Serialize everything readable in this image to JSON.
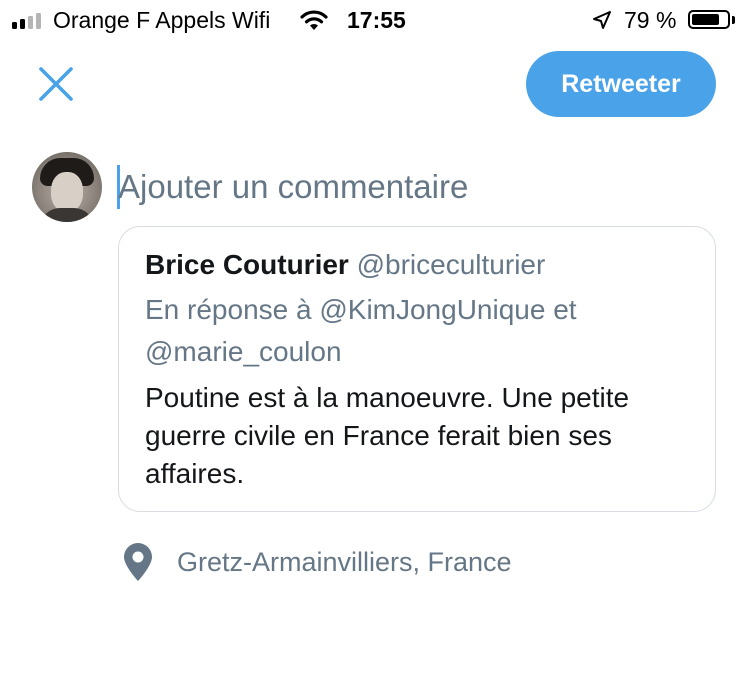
{
  "status_bar": {
    "carrier": "Orange F Appels Wifi",
    "time": "17:55",
    "battery_percent": "79 %",
    "battery_level": 0.79,
    "signal_bars_filled": 2,
    "icons": [
      "signal-icon",
      "wifi-icon",
      "location-arrow-icon",
      "battery-icon"
    ]
  },
  "header": {
    "close_icon": "close-icon",
    "retweet_label": "Retweeter"
  },
  "compose": {
    "avatar_icon": "avatar",
    "comment_placeholder": "Ajouter un commentaire",
    "comment_value": ""
  },
  "quoted_tweet": {
    "author_name": "Brice Couturier",
    "author_handle": "@briceculturier",
    "reply_to": "En réponse à @KimJongUnique et @marie_coulon",
    "text": "Poutine est à la manoeuvre. Une petite guerre civile en France ferait bien ses affaires."
  },
  "location": {
    "icon": "map-pin-icon",
    "label": "Gretz-Armainvilliers, France"
  },
  "colors": {
    "accent": "#4aa3e8",
    "secondary_text": "#657786",
    "primary_text": "#14171a",
    "card_border": "#d7dde2"
  }
}
